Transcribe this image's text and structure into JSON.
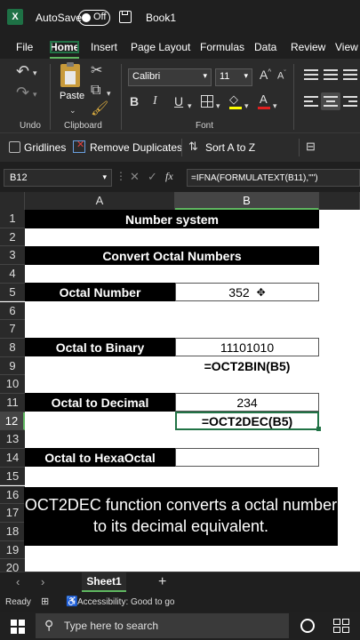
{
  "titlebar": {
    "logo": "X",
    "autosave_label": "AutoSave",
    "toggle_state": "Off",
    "filename": "Book1"
  },
  "menu": [
    "File",
    "Home",
    "Insert",
    "Page Layout",
    "Formulas",
    "Data",
    "Review",
    "View"
  ],
  "ribbon": {
    "undo_group": "Undo",
    "clipboard_group": "Clipboard",
    "paste_label": "Paste",
    "font_group": "Font",
    "font_name": "Calibri",
    "font_size": "11",
    "bold": "B",
    "italic": "I",
    "underline": "U",
    "font_color_a": "A"
  },
  "quickbar": {
    "gridlines": "Gridlines",
    "remove_duplicates": "Remove Duplicates",
    "sort": "Sort A to Z"
  },
  "formula_bar": {
    "name_box": "B12",
    "fx": "fx",
    "formula": "=IFNA(FORMULATEXT(B11),\"\")"
  },
  "columns": [
    "A",
    "B"
  ],
  "rows": [
    "1",
    "2",
    "3",
    "4",
    "5",
    "6",
    "7",
    "8",
    "9",
    "10",
    "11",
    "12",
    "13",
    "14",
    "15",
    "16",
    "17",
    "18",
    "19",
    "20"
  ],
  "cells": {
    "r1": "Number system",
    "r3": "Convert Octal Numbers",
    "r5_label": "Octal Number",
    "r5_value": "352",
    "r8_label": "Octal to Binary",
    "r8_value": "11101010",
    "r9_value": "=OCT2BIN(B5)",
    "r11_label": "Octal to Decimal",
    "r11_value": "234",
    "r12_value": "=OCT2DEC(B5)",
    "r14_label": "Octal to HexaOctal"
  },
  "caption": "OCT2DEC function converts a octal number to its decimal equivalent.",
  "sheet_tab": "Sheet1",
  "status": {
    "ready": "Ready",
    "accessibility": "Accessibility: Good to go"
  },
  "taskbar": {
    "search_placeholder": "Type here to search"
  },
  "colors": {
    "excel_green": "#217346",
    "tab_underline": "#5fb760",
    "banner_bg": "#000000"
  }
}
